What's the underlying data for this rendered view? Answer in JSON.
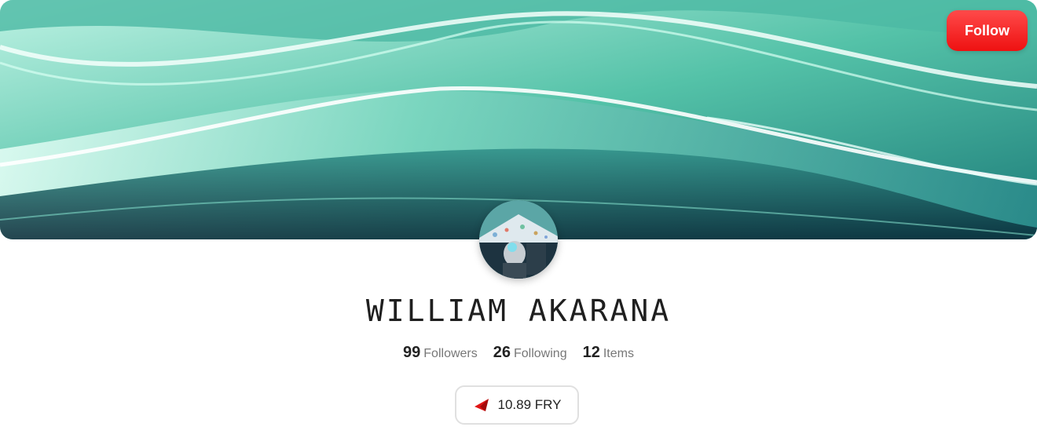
{
  "header": {
    "follow_label": "Follow"
  },
  "profile": {
    "name": "WILLIAM AKARANA",
    "stats": [
      {
        "value": "99",
        "label": "Followers"
      },
      {
        "value": "26",
        "label": "Following"
      },
      {
        "value": "12",
        "label": "Items"
      }
    ],
    "balance": "10.89 FRY",
    "balance_icon": "red-token-icon"
  },
  "colors": {
    "accent": "#ee1111",
    "banner_primary": "#3fa99a",
    "banner_dark": "#0a2f3e"
  }
}
